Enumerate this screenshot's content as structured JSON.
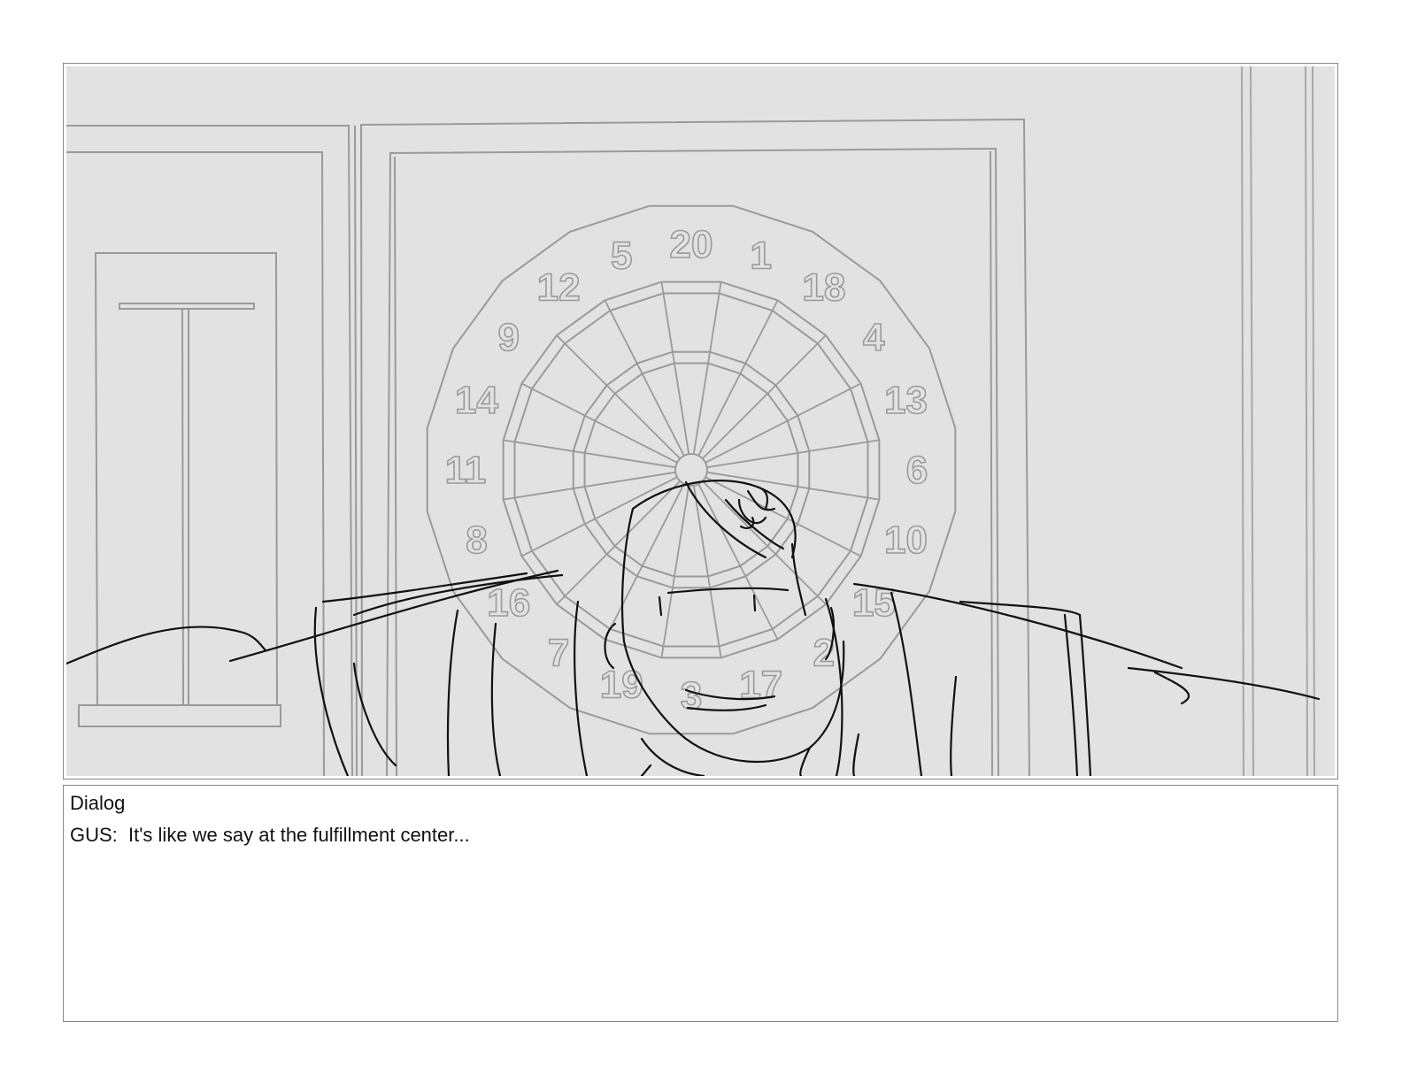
{
  "panel": {
    "dartboard_numbers": [
      "20",
      "1",
      "18",
      "4",
      "13",
      "6",
      "10",
      "15",
      "2",
      "17",
      "3",
      "19",
      "7",
      "16",
      "8",
      "11",
      "14",
      "9",
      "12",
      "5"
    ]
  },
  "dialog": {
    "heading": "Dialog",
    "line": "GUS:  It's like we say at the fulfillment center..."
  }
}
